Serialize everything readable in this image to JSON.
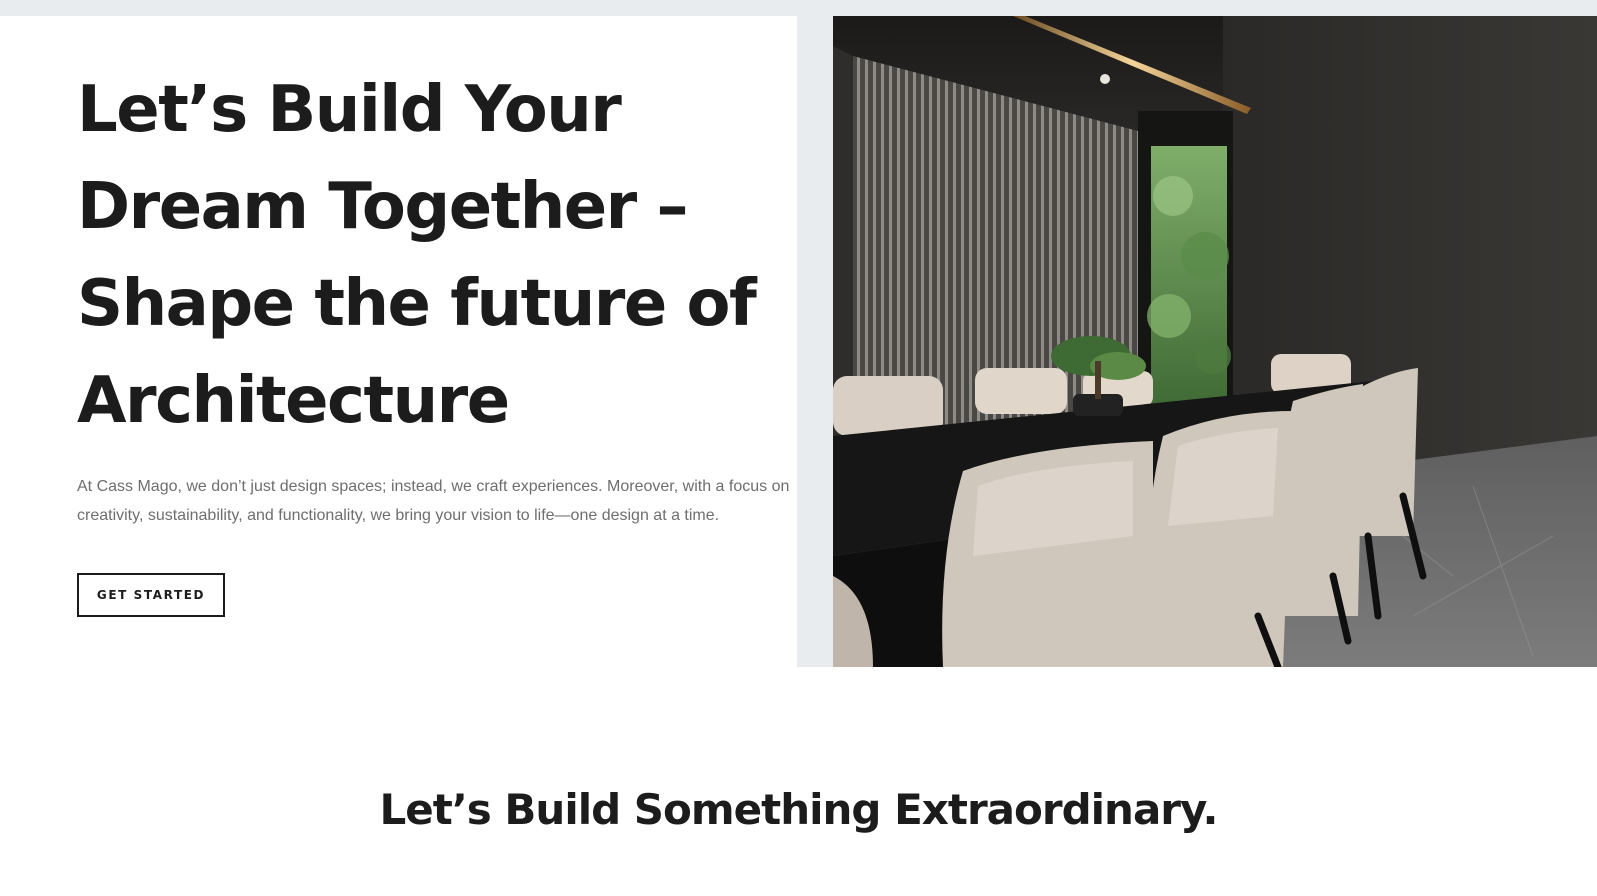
{
  "hero": {
    "title_lines": [
      "Let’s Build Your",
      "Dream Together –",
      "Shape the future of",
      "Architecture"
    ],
    "description": "At Cass Mago, we don’t just design spaces; instead, we craft experiences. Moreover, with a focus on creativity, sustainability, and functionality, we bring your vision to life—one design at a time.",
    "cta_label": "GET STARTED",
    "image_icon": "photo-meeting-room"
  },
  "section": {
    "heading": "Let’s Build Something Extraordinary."
  },
  "colors": {
    "text_dark": "#1c1c1c",
    "text_muted": "#6e6e6e",
    "gutter": "#e8ecef",
    "background": "#ffffff"
  }
}
